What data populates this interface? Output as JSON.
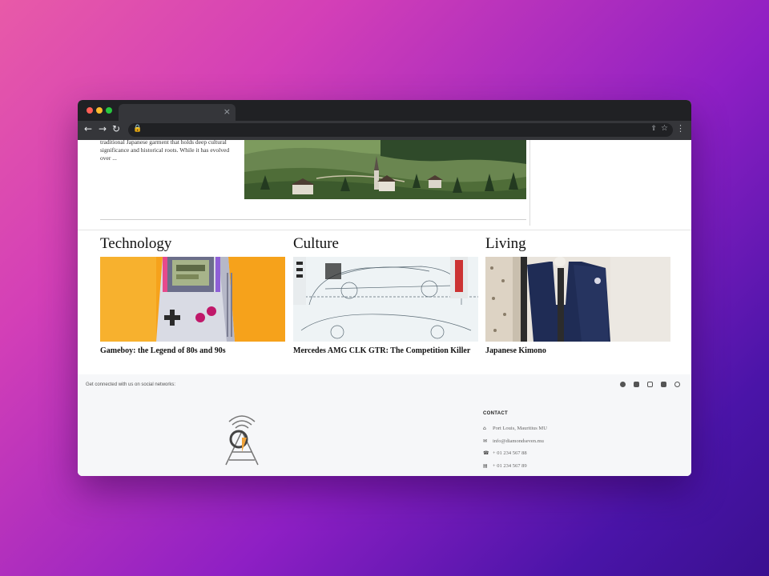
{
  "browser": {
    "tab_close": "×",
    "back": "←",
    "forward": "→",
    "reload": "↻",
    "lock": "🔒",
    "share": "⇪",
    "star": "☆",
    "menu": "⋮",
    "traffic_colors": [
      "#ff5f57",
      "#febc2e",
      "#28c840"
    ]
  },
  "page": {
    "snippet": "traditional Japanese garment that holds deep cultural significance and historical roots. While it has evolved over ...",
    "categories": [
      {
        "heading": "Technology",
        "title": "Gameboy: the Legend of 80s and 90s",
        "image": "gameboy"
      },
      {
        "heading": "Culture",
        "title": "Mercedes AMG CLK GTR: The Competition Killer",
        "image": "race-car-blueprint"
      },
      {
        "heading": "Living",
        "title": "Japanese Kimono",
        "image": "kimono"
      }
    ]
  },
  "footer": {
    "social_text": "Get connected with us on social networks:",
    "social_icons": [
      "facebook-icon",
      "twitter-icon",
      "x-icon",
      "linkedin-icon",
      "whatsapp-icon"
    ],
    "contact_heading": "CONTACT",
    "address": "Port Louis, Mauritius MU",
    "email": "info@diamondseven.mu",
    "phone": "+ 01 234 567 88",
    "fax": "+ 01 234 567 89"
  }
}
